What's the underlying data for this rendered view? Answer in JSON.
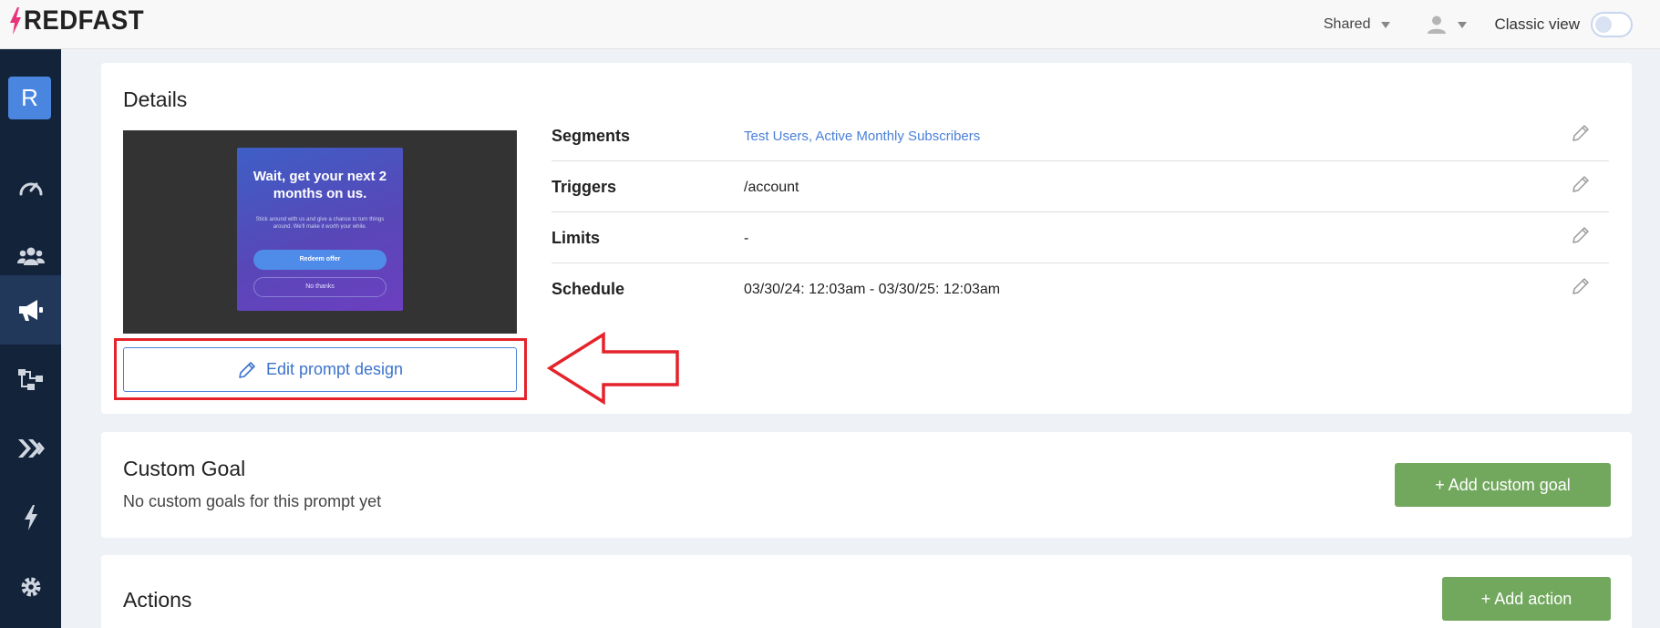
{
  "app": {
    "logo_text": "REDFAST"
  },
  "topbar": {
    "shared_label": "Shared",
    "classic_view_label": "Classic view"
  },
  "sidebar": {
    "avatar_letter": "R"
  },
  "details": {
    "title": "Details",
    "preview": {
      "headline": "Wait, get your next 2 months on us.",
      "subtext": "Stick around with us and give a chance to turn things around. We'll make it worth your while.",
      "primary_button": "Redeem offer",
      "secondary_button": "No thanks"
    },
    "edit_button_label": "Edit prompt design",
    "rows": [
      {
        "label": "Segments",
        "value": "Test Users, Active Monthly Subscribers"
      },
      {
        "label": "Triggers",
        "value": "/account"
      },
      {
        "label": "Limits",
        "value": "-"
      },
      {
        "label": "Schedule",
        "value": "03/30/24: 12:03am - 03/30/25: 12:03am"
      }
    ]
  },
  "custom_goal": {
    "title": "Custom Goal",
    "empty_text": "No custom goals for this prompt yet",
    "add_button": "+ Add custom goal"
  },
  "actions": {
    "title": "Actions",
    "add_button": "+ Add action"
  },
  "colors": {
    "sidebar_bg": "#13233a",
    "accent_blue": "#4a80d8",
    "green": "#72a85e",
    "highlight_red": "#e4232b",
    "logo_pink": "#e8347a"
  }
}
